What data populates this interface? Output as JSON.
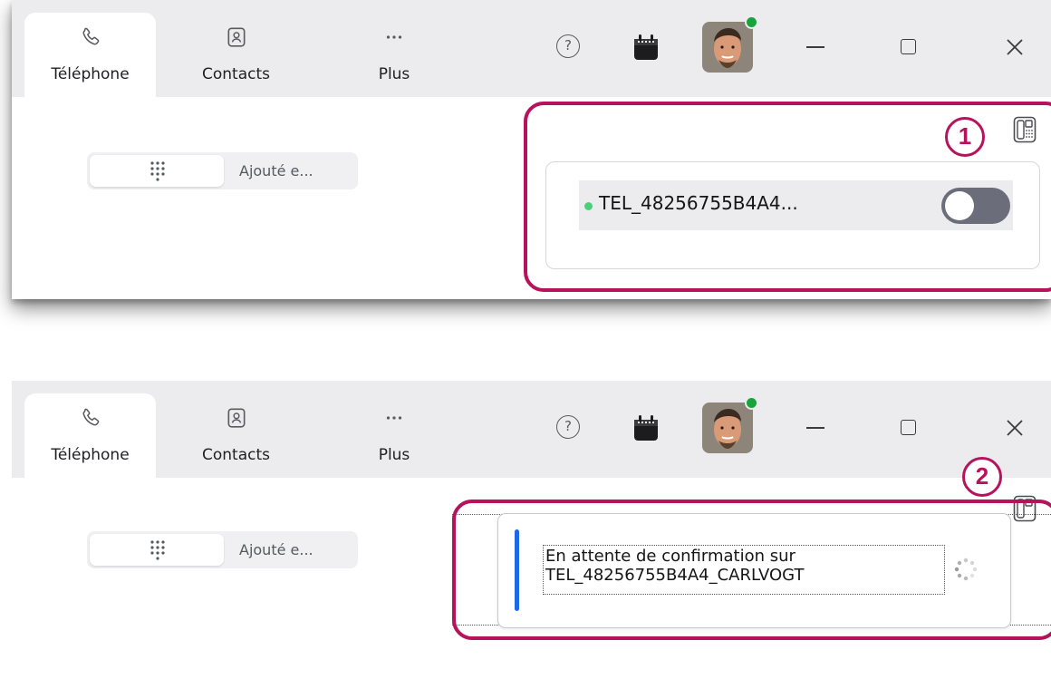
{
  "tabs": {
    "phone": "Téléphone",
    "contacts": "Contacts",
    "more": "Plus"
  },
  "toolbar": {
    "help_symbol": "?"
  },
  "segment": {
    "label": "Ajouté e..."
  },
  "device": {
    "name": "TEL_48256755B4A4...",
    "status_color": "#4bd07a",
    "toggle_on": false
  },
  "confirmation": {
    "line1": "En attente de confirmation sur",
    "line2": "TEL_48256755B4A4_CARLVOGT"
  },
  "callouts": {
    "one": "1",
    "two": "2"
  },
  "colors": {
    "accent": "#b6135c",
    "presence": "#1aa33c",
    "info_bar": "#1c68e6"
  },
  "icons": [
    "phone-icon",
    "contact-card-icon",
    "more-icon",
    "help-icon",
    "calendar-icon",
    "desk-phone-icon",
    "dialpad-icon",
    "spinner-icon"
  ]
}
